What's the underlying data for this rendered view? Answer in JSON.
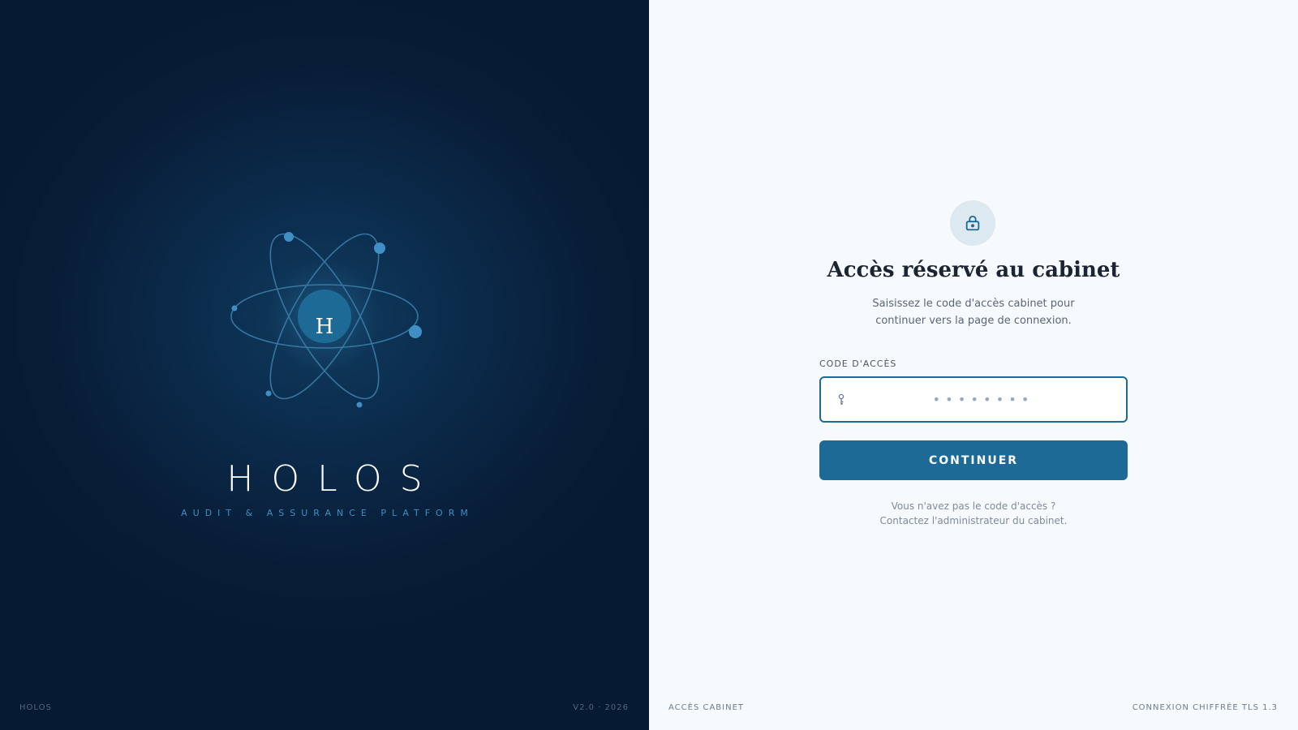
{
  "brand": {
    "monogram": "H",
    "name": "HOLOS",
    "tagline": "AUDIT & ASSURANCE PLATFORM",
    "footer_left": "HOLOS",
    "footer_right": "V2.0 · 2026",
    "icon": "atom-logo-icon"
  },
  "form": {
    "icon": "lock-icon",
    "title": "Accès réservé au cabinet",
    "subtitle_line1": "Saisissez le code d'accès cabinet pour",
    "subtitle_line2": "continuer vers la page de connexion.",
    "field_label": "CODE D'ACCÈS",
    "field_icon": "key-icon",
    "field_placeholder": "••••••••",
    "field_value": "",
    "button_label": "CONTINUER",
    "help_question": "Vous n'avez pas le code d'accès ?",
    "help_contact": "Contactez l'administrateur du cabinet."
  },
  "footer": {
    "left": "ACCÈS CABINET",
    "right": "CONNEXION CHIFFRÉE TLS 1.3"
  },
  "colors": {
    "brand_dark": "#081c36",
    "accent": "#1e6a96",
    "tagline": "#3f8fc4",
    "page_bg": "#f7fafc"
  }
}
